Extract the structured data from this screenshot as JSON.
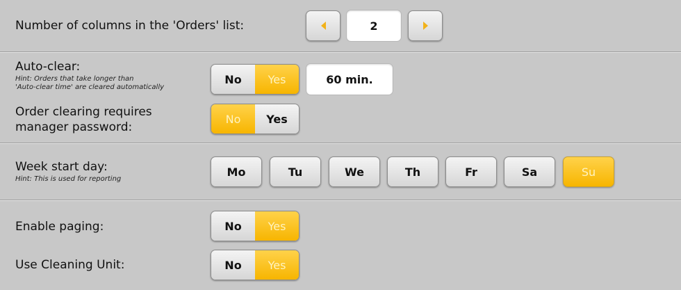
{
  "columns": {
    "label": "Number of columns in the 'Orders' list:",
    "value": "2",
    "prev_icon": "arrow-left-icon",
    "next_icon": "arrow-right-icon"
  },
  "auto_clear": {
    "label": "Auto-clear:",
    "hint_line1": "Hint: Orders that take longer than",
    "hint_line2": "'Auto-clear time' are cleared automatically",
    "no": "No",
    "yes": "Yes",
    "selected": "Yes",
    "time": "60 min."
  },
  "manager_password": {
    "label_line1": "Order clearing requires",
    "label_line2": "manager password:",
    "no": "No",
    "yes": "Yes",
    "selected": "No"
  },
  "week_start": {
    "label": "Week start day:",
    "hint": "Hint: This is used for reporting",
    "days": [
      "Mo",
      "Tu",
      "We",
      "Th",
      "Fr",
      "Sa",
      "Su"
    ],
    "selected": "Su"
  },
  "paging": {
    "label": "Enable paging:",
    "no": "No",
    "yes": "Yes",
    "selected": "Yes"
  },
  "cleaning_unit": {
    "label": "Use Cleaning Unit:",
    "no": "No",
    "yes": "Yes",
    "selected": "Yes"
  },
  "colors": {
    "accent": "#f7b500",
    "background": "#c8c8c8"
  }
}
